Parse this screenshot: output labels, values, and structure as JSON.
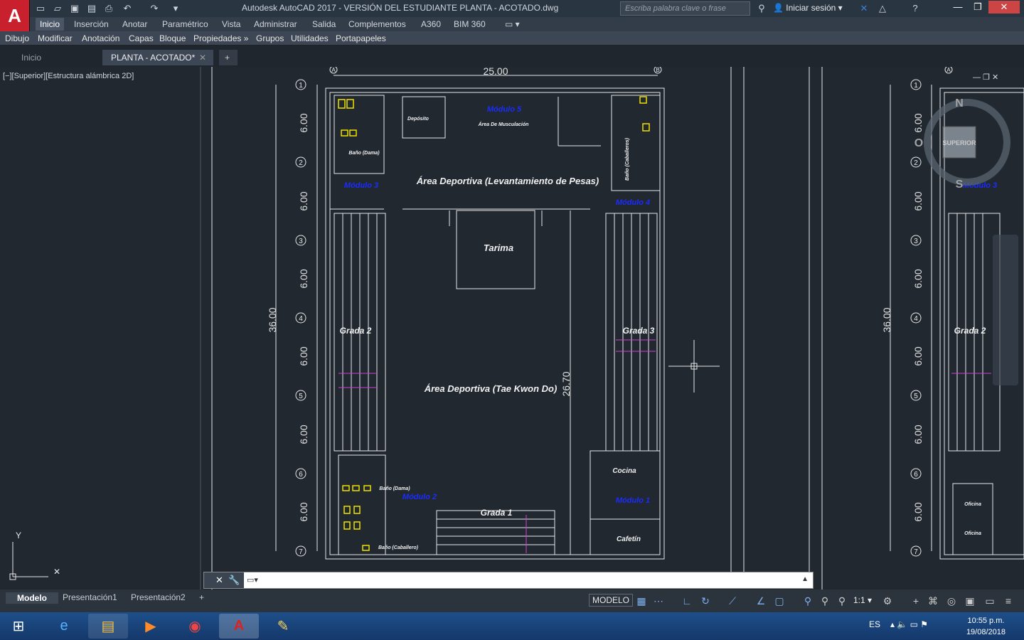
{
  "window": {
    "title": "Autodesk AutoCAD 2017 - VERSIÓN DEL ESTUDIANTE    PLANTA - ACOTADO.dwg",
    "search_placeholder": "Escriba palabra clave o frase",
    "signin": "Iniciar sesión",
    "app_letter": "A"
  },
  "ribbon_tabs": [
    "Inicio",
    "Inserción",
    "Anotar",
    "Paramétrico",
    "Vista",
    "Administrar",
    "Salida",
    "Complementos",
    "A360",
    "BIM 360"
  ],
  "panels": [
    "Dibujo",
    "Modificar",
    "Anotación",
    "Capas",
    "Bloque",
    "Propiedades »",
    "Grupos",
    "Utilidades",
    "Portapapeles"
  ],
  "doc_tabs": [
    "Inicio",
    "PLANTA - ACOTADO*"
  ],
  "viewport_label": "[−][Superior][Estructura alámbrica 2D]",
  "layout_tabs": [
    "Modelo",
    "Presentación1",
    "Presentación2"
  ],
  "status": {
    "model": "MODELO",
    "scale": "1:1"
  },
  "taskbar": {
    "lang": "ES",
    "time": "10:55 p.m.",
    "date": "19/08/2018"
  },
  "plan": {
    "top_dim": "25.00",
    "left_dim": "36.00",
    "inner_dim": "26.70",
    "axes_rows": [
      "1",
      "2",
      "3",
      "4",
      "5",
      "6",
      "7"
    ],
    "axes_cols": [
      "A",
      "B"
    ],
    "row_spacing": "6.00",
    "labels": {
      "mod5": "Módulo 5",
      "musc": "Área De Musculación",
      "deposito": "Depósito",
      "pesas": "Área Deportiva (Levantamiento de Pesas)",
      "tarima": "Tarima",
      "taekwondo": "Área Deportiva (Tae Kwon Do)",
      "grada1": "Grada 1",
      "grada2": "Grada 2",
      "grada3": "Grada 3",
      "mod1": "Módulo 1",
      "mod2": "Módulo 2",
      "mod3": "Módulo 3",
      "mod4": "Módulo 4",
      "cocina": "Cocina",
      "cafetin": "Cafetín",
      "bano_dama": "Baño (Dama)",
      "bano_cab": "Baño (Caballero)",
      "bano_cab_v": "Baño (Caballeros)",
      "oficina": "Oficina"
    },
    "viewcube": {
      "n": "N",
      "s": "S",
      "o": "O",
      "face": "SUPERIOR"
    }
  }
}
